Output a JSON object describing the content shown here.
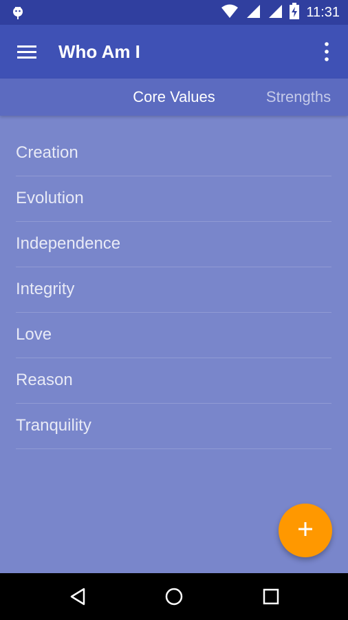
{
  "status_bar": {
    "time": "11:31",
    "icons": [
      "android-notification-icon",
      "wifi-icon",
      "signal-icon",
      "signal-icon",
      "battery-charging-icon"
    ]
  },
  "app_bar": {
    "title": "Who Am I",
    "menu_icon": "hamburger-menu-icon",
    "overflow_icon": "more-vert-icon"
  },
  "tabs": [
    {
      "label": "Core Values",
      "selected": true
    },
    {
      "label": "Strengths",
      "selected": false
    }
  ],
  "values_list": {
    "items": [
      "Creation",
      "Evolution",
      "Independence",
      "Integrity",
      "Love",
      "Reason",
      "Tranquility"
    ]
  },
  "fab": {
    "icon": "plus-icon",
    "color": "#FF9800"
  },
  "nav_bar": {
    "icons": [
      "back-icon",
      "home-icon",
      "recent-apps-icon"
    ]
  },
  "colors": {
    "primary": "#3F51B5",
    "primary_dark": "#303F9F",
    "tab_bar": "#5C6BC0",
    "background": "#7986CB",
    "accent": "#FF9800"
  }
}
